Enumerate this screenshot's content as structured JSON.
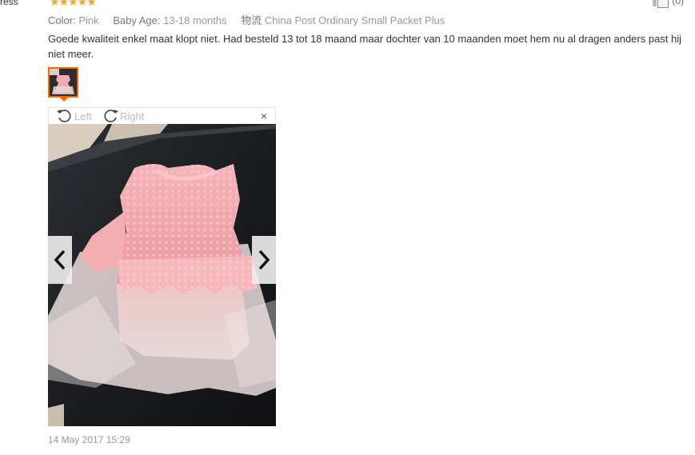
{
  "header": {
    "user_fragment": "ress",
    "stars": "★★★★★",
    "helpful_count": "(0)"
  },
  "review": {
    "attributes": [
      {
        "label": "Color:",
        "value": "Pink"
      },
      {
        "label": "Baby Age:",
        "value": "13-18 months"
      },
      {
        "label": "物流",
        "value": "China Post Ordinary Small Packet Plus"
      }
    ],
    "text": "Goede kwaliteit enkel maat klopt niet. Had besteld 13 tot 18 maand maar dochter van 10 maanden moet hem nu al dragen anders past hij niet meer.",
    "date": "14 May 2017 15:29"
  },
  "viewer": {
    "rotate_left_label": "Left",
    "rotate_right_label": "Right",
    "close_label": "×"
  },
  "colors": {
    "accent": "#ff6600",
    "star": "#f5a623",
    "muted": "#999999",
    "dress_pink": "#f0a8ad",
    "table_dark": "#16181b"
  },
  "rating": 5
}
